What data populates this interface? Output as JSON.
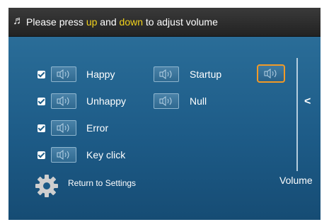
{
  "header": {
    "prefix": "Please press ",
    "up": "up",
    "middle": " and ",
    "down": "down",
    "suffix": " to adjust volume",
    "icon": "music-note-icon"
  },
  "sounds": [
    {
      "label": "Happy",
      "checked": true
    },
    {
      "label": "Unhappy",
      "checked": true
    },
    {
      "label": "Error",
      "checked": true
    },
    {
      "label": "Key click",
      "checked": true
    }
  ],
  "sounds_right": [
    {
      "label": "Startup"
    },
    {
      "label": "Null"
    }
  ],
  "return_label": "Return to Settings",
  "volume_label": "Volume",
  "colors": {
    "highlight": "#f2d21b",
    "selected_border": "#f29a26",
    "panel": "#1f5f8a"
  }
}
